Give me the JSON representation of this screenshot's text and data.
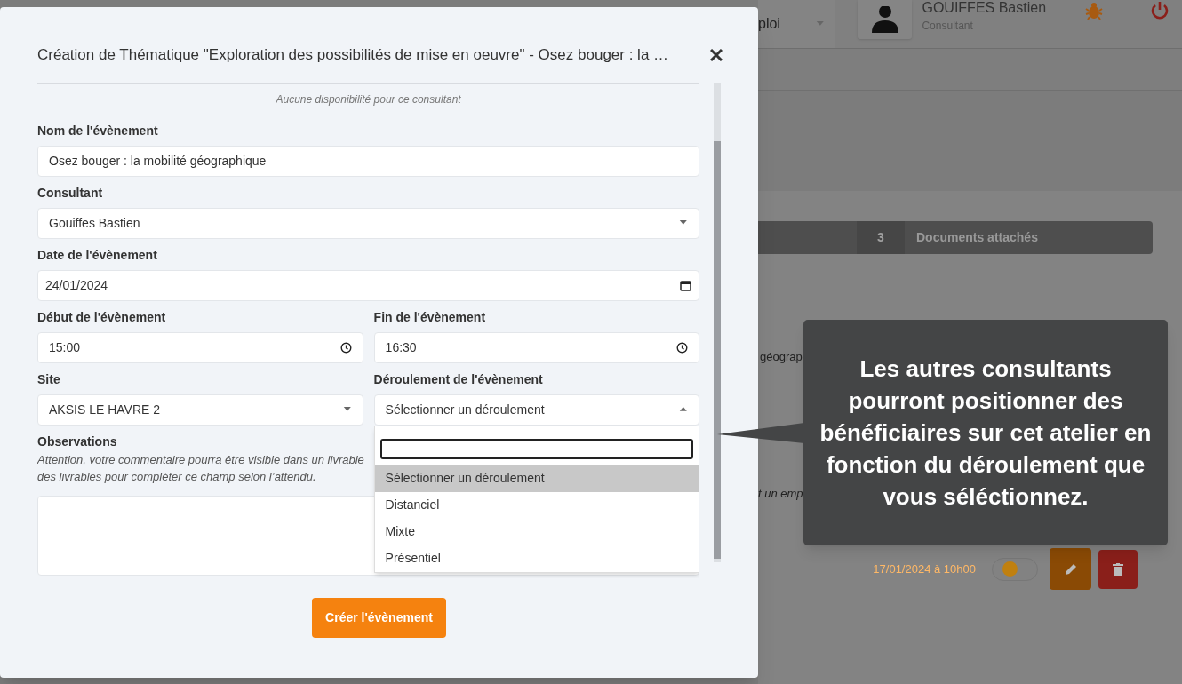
{
  "background": {
    "header": {
      "dropdown_text": "ploi",
      "user_name": "GOUIFFES Bastien",
      "user_role": "Consultant"
    },
    "tab": {
      "count": "3",
      "label": "Documents attachés"
    },
    "fragments": [
      "géograp",
      "t un emp"
    ],
    "event": {
      "date": "17/01/2024 à 10h00",
      "toggle_on": false
    }
  },
  "modal": {
    "title": "Création de Thématique \"Exploration des possibilités de mise en oeuvre\" - Osez bouger : la …",
    "notice": "Aucune disponibilité pour ce consultant",
    "rows": [
      {
        "fields": [
          {
            "kind": "text",
            "label": "Nom de l'évènement",
            "value": "Osez bouger : la mobilité géographique"
          }
        ]
      },
      {
        "fields": [
          {
            "kind": "select",
            "label": "Consultant",
            "value": "Gouiffes Bastien",
            "open": false
          }
        ]
      },
      {
        "fields": [
          {
            "kind": "date",
            "label": "Date de l'évènement",
            "value": "24/01/2024"
          }
        ]
      },
      {
        "fields": [
          {
            "kind": "time",
            "label": "Début de l'évènement",
            "value": "15:00"
          },
          {
            "kind": "time",
            "label": "Fin de l'évènement",
            "value": "16:30"
          }
        ]
      },
      {
        "fields": [
          {
            "kind": "select",
            "label": "Site",
            "value": "AKSIS LE HAVRE 2",
            "open": false
          },
          {
            "kind": "select",
            "label": "Déroulement de l'évènement",
            "value": "Sélectionner un déroulement",
            "open": true
          }
        ]
      }
    ],
    "observations": {
      "label": "Observations",
      "hint_lines": [
        "Attention, votre commentaire pourra être visible dans un livrable",
        "des livrables pour compléter ce champ selon l’attendu."
      ]
    },
    "submit": "Créer l'évènement"
  },
  "dropdown": {
    "options": [
      {
        "label": "Sélectionner un déroulement",
        "selected": true
      },
      {
        "label": "Distanciel",
        "selected": false
      },
      {
        "label": "Mixte",
        "selected": false
      },
      {
        "label": "Présentiel",
        "selected": false
      }
    ]
  },
  "tooltip": {
    "text": "Les autres consultants pourront positionner des bénéficiaires sur cet atelier en fonction du déroulement que vous séléctionnez."
  }
}
